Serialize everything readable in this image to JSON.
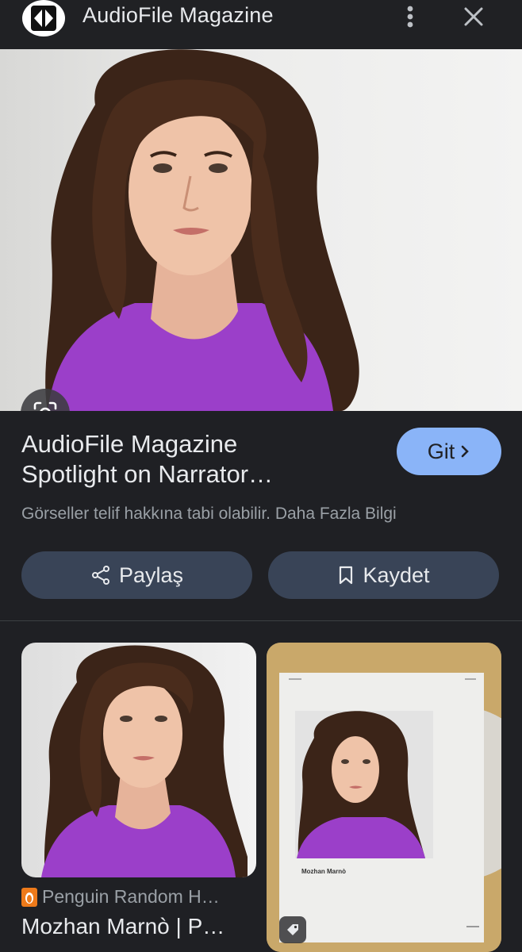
{
  "header": {
    "site_name": "AudioFile Magazine",
    "logo_icon": "audiofile-logo-icon",
    "more_icon": "more-vert-icon",
    "close_icon": "close-icon"
  },
  "hero": {
    "image_alt": "woman with long brown wavy hair in purple top",
    "lens_icon": "lens-search-icon"
  },
  "info": {
    "title_line1": "AudioFile Magazine",
    "title_line2": "Spotlight on Narrator…",
    "go_label": "Git",
    "copyright_note": "Görseller telif hakkına tabi olabilir. Daha Fazla Bilgi",
    "share_label": "Paylaş",
    "save_label": "Kaydet"
  },
  "related": [
    {
      "source": "Penguin Random H…",
      "title": "Mozhan Marnò | P…"
    },
    {
      "caption": "Mozhan Marnò",
      "badge_icon": "tag-icon"
    }
  ],
  "colors": {
    "accent": "#8ab4f8",
    "button_bg": "#394457",
    "background": "#1f2024",
    "purple_top": "#9b3fc9"
  }
}
